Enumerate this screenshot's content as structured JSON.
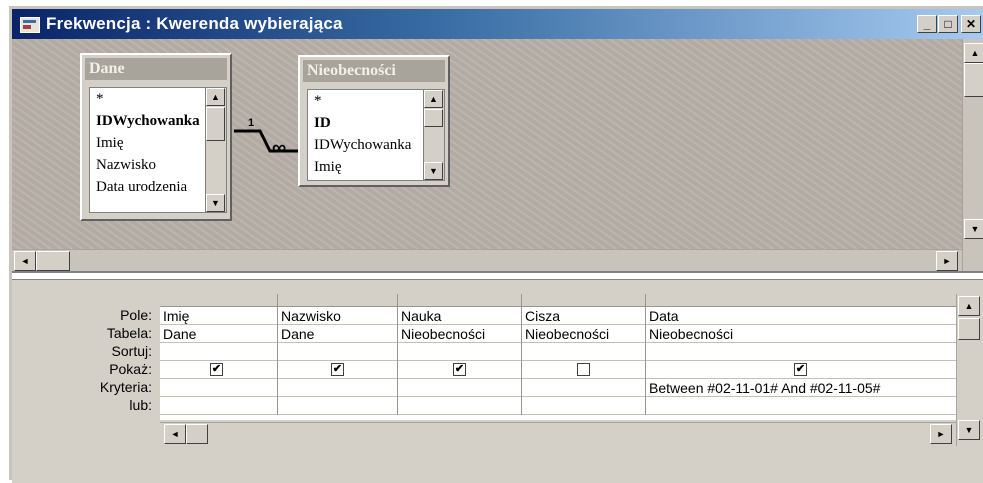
{
  "window": {
    "title": "Frekwencja : Kwerenda wybierająca",
    "controls": {
      "minimize": "_",
      "maximize": "□",
      "close": "✕"
    }
  },
  "tables": [
    {
      "name": "Dane",
      "fields": [
        "*",
        "IDWychowanka",
        "Imię",
        "Nazwisko",
        "Data urodzenia"
      ],
      "key_field_index": 1
    },
    {
      "name": "Nieobecności",
      "fields": [
        "*",
        "ID",
        "IDWychowanka",
        "Imię"
      ],
      "key_field_index": 1
    }
  ],
  "relationship": {
    "one_label": "1",
    "many_label": "∞"
  },
  "grid": {
    "row_labels": [
      "Pole:",
      "Tabela:",
      "Sortuj:",
      "Pokaż:",
      "Kryteria:",
      "lub:"
    ],
    "columns": [
      {
        "field": "Imię",
        "table": "Dane",
        "sort": "",
        "show": true,
        "criteria": "",
        "or": ""
      },
      {
        "field": "Nazwisko",
        "table": "Dane",
        "sort": "",
        "show": true,
        "criteria": "",
        "or": ""
      },
      {
        "field": "Nauka",
        "table": "Nieobecności",
        "sort": "",
        "show": true,
        "criteria": "",
        "or": ""
      },
      {
        "field": "Cisza",
        "table": "Nieobecności",
        "sort": "",
        "show": false,
        "criteria": "",
        "or": ""
      },
      {
        "field": "Data",
        "table": "Nieobecności",
        "sort": "",
        "show": true,
        "criteria": "Between #02-11-01# And #02-11-05#",
        "or": ""
      }
    ]
  },
  "icons": {
    "scroll_up": "▲",
    "scroll_down": "▼",
    "scroll_left": "◄",
    "scroll_right": "►",
    "check": "✔"
  }
}
